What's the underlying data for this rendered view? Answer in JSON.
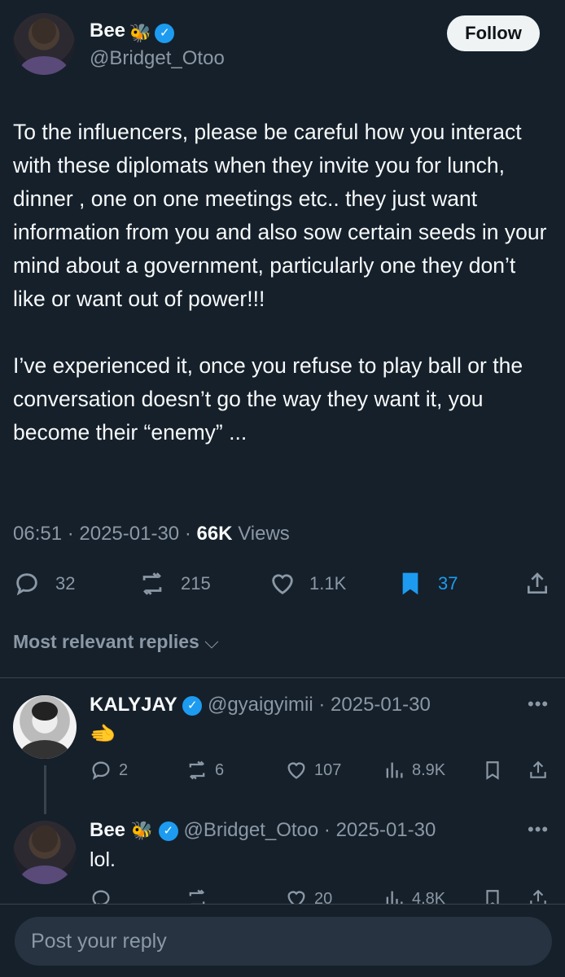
{
  "tweet": {
    "author_name": "Bee",
    "author_emoji": "🐝",
    "author_handle": "@Bridget_Otoo",
    "follow_label": "Follow",
    "paragraph_1": "To the influencers, please be careful how you interact with these diplomats when they invite you for lunch, dinner , one on one meetings etc.. they just want information from you and also sow certain seeds in your mind about a government, particularly one they don’t like or want out of power!!!",
    "paragraph_2": "I’ve experienced it, once you refuse to play ball or the conversation doesn’t go the way they want it, you become their “enemy” ...",
    "time": "06:51",
    "date": "2025-01-30",
    "views_count": "66K",
    "views_label": "Views",
    "replies": "32",
    "reposts": "215",
    "likes": "1.1K",
    "bookmarks": "37",
    "accent_color": "#1d9bf0"
  },
  "replies_section": {
    "sort_label": "Most relevant replies"
  },
  "replies": [
    {
      "name": "KALYJAY",
      "handle": "@gyaigyimii",
      "date": "2025-01-30",
      "text": "🫲",
      "replies": "2",
      "reposts": "6",
      "likes": "107",
      "views": "8.9K"
    },
    {
      "name": "Bee",
      "emoji": "🐝",
      "handle": "@Bridget_Otoo",
      "date": "2025-01-30",
      "text": "lol.",
      "replies": "",
      "reposts": "",
      "likes": "20",
      "views": "4.8K"
    }
  ],
  "composer": {
    "placeholder": "Post your reply"
  }
}
